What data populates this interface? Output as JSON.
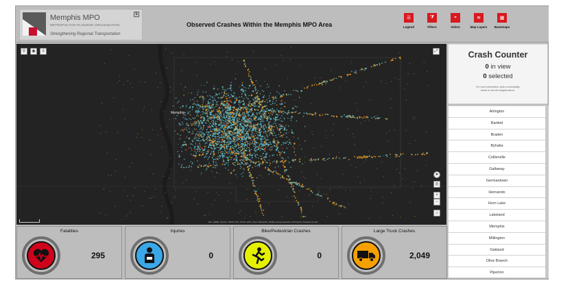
{
  "header": {
    "logo": {
      "title": "Memphis MPO",
      "subtitle": "METROPOLITAN PLANNING ORGANIZATION",
      "tagline": "Strengthening Regional Transportation",
      "corner_icon": "external-link-icon"
    },
    "title": "Observed Crashes Within the Memphis MPO Area",
    "tools": [
      {
        "label": "Legend",
        "icon": "legend-icon"
      },
      {
        "label": "Filters",
        "icon": "filter-icon"
      },
      {
        "label": "Select",
        "icon": "select-icon"
      },
      {
        "label": "Map Layers",
        "icon": "layers-icon"
      },
      {
        "label": "Basemaps",
        "icon": "basemap-icon"
      }
    ],
    "accent": "#d71920"
  },
  "map": {
    "top_left_tools": [
      "search-icon",
      "layers-icon",
      "list-icon"
    ],
    "fullscreen_icon": "fullscreen-icon",
    "side_tools": [
      "compass-icon",
      "locate-icon",
      "zoom-in-icon",
      "zoom-out-icon",
      "home-icon"
    ],
    "city_label": "Memphis",
    "attribution": "Esri, HERE, Garmin, USGS, FAO, NOAA, EPA | City of Memphis, Shelby County Assessor of Property | Powered by Esri"
  },
  "counter": {
    "title": "Crash Counter",
    "in_view_value": "0",
    "in_view_label": "in view",
    "selected_value": "0",
    "selected_label": "selected",
    "note": "For more information, click a municipality below or use the widgets above."
  },
  "municipalities": [
    "Arlington",
    "Bartlett",
    "Braden",
    "Byhalia",
    "Collierville",
    "Gallaway",
    "Germantown",
    "Hernando",
    "Horn Lake",
    "Lakeland",
    "Memphis",
    "Millington",
    "Oakland",
    "Olive Branch",
    "Piperton"
  ],
  "stats": [
    {
      "label": "Fatalities",
      "value": "295",
      "icon": "heart-pulse-icon",
      "color": "#d0021b"
    },
    {
      "label": "Injuries",
      "value": "0",
      "icon": "injured-person-icon",
      "color": "#3aa7e8"
    },
    {
      "label": "Bike/Pedestrian Crashes",
      "value": "0",
      "icon": "pedestrian-icon",
      "color": "#e4f200"
    },
    {
      "label": "Large Truck Crashes",
      "value": "2,049",
      "icon": "truck-icon",
      "color": "#f5a000"
    }
  ]
}
